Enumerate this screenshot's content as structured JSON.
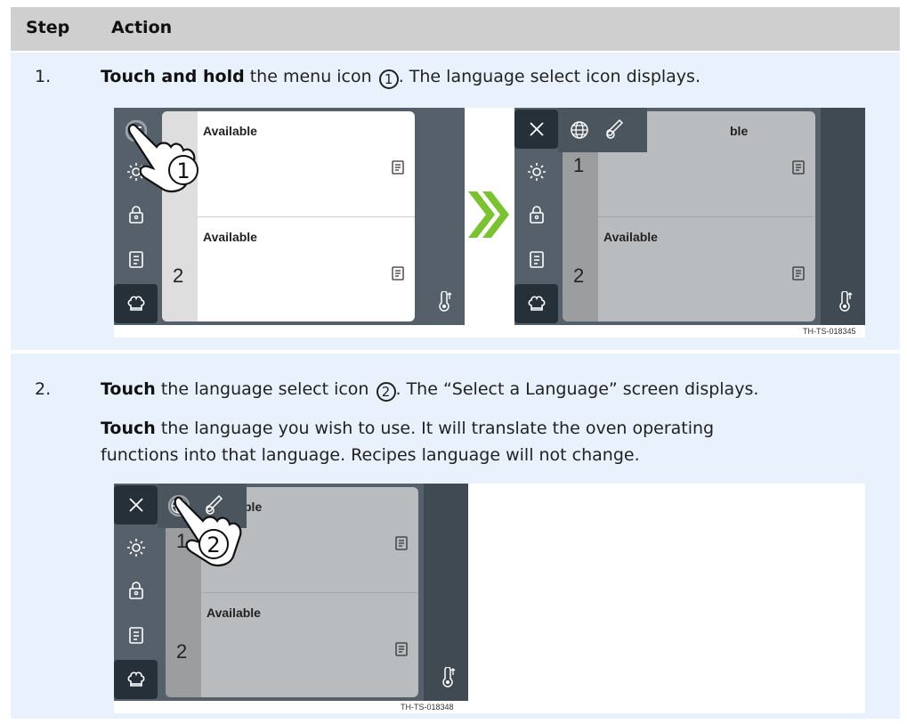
{
  "table": {
    "headers": {
      "step": "Step",
      "action": "Action"
    },
    "row1": {
      "number": "1.",
      "bold": "Touch and hold",
      "text1": " the menu icon ",
      "marker": "1",
      "text2": ". The language select icon displays.",
      "figure_code": "TH-TS-018345"
    },
    "row2": {
      "number": "2.",
      "bold": "Touch",
      "text1": " the language select icon ",
      "marker": "2",
      "text2": ". The “Select a Language” screen displays.",
      "p2_bold": "Touch",
      "p2_line1": " the language you wish to use. It will translate the oven operating",
      "p2_line2": "functions into that language. Recipes language will not change.",
      "figure_code": "TH-TS-018348"
    }
  },
  "oven_screen": {
    "card1_title": "Available",
    "card2_title": "Available",
    "card1_title_partial": "ble",
    "slot1": "1",
    "slot2": "2",
    "callout1": "1",
    "callout2": "2"
  },
  "colors": {
    "header_bg": "#cfcfcf",
    "row_bg": "#e8f1fc",
    "sidebar": "#55606b",
    "arrow_green": "#7ac231"
  },
  "icons": [
    "menu-icon",
    "sun-icon",
    "lock-icon",
    "recipe-icon",
    "chef-hat-icon",
    "close-icon",
    "globe-icon",
    "thermometer-probe-icon",
    "document-icon",
    "core-probe-icon",
    "hand-pointer-icon",
    "double-chevron-icon"
  ]
}
